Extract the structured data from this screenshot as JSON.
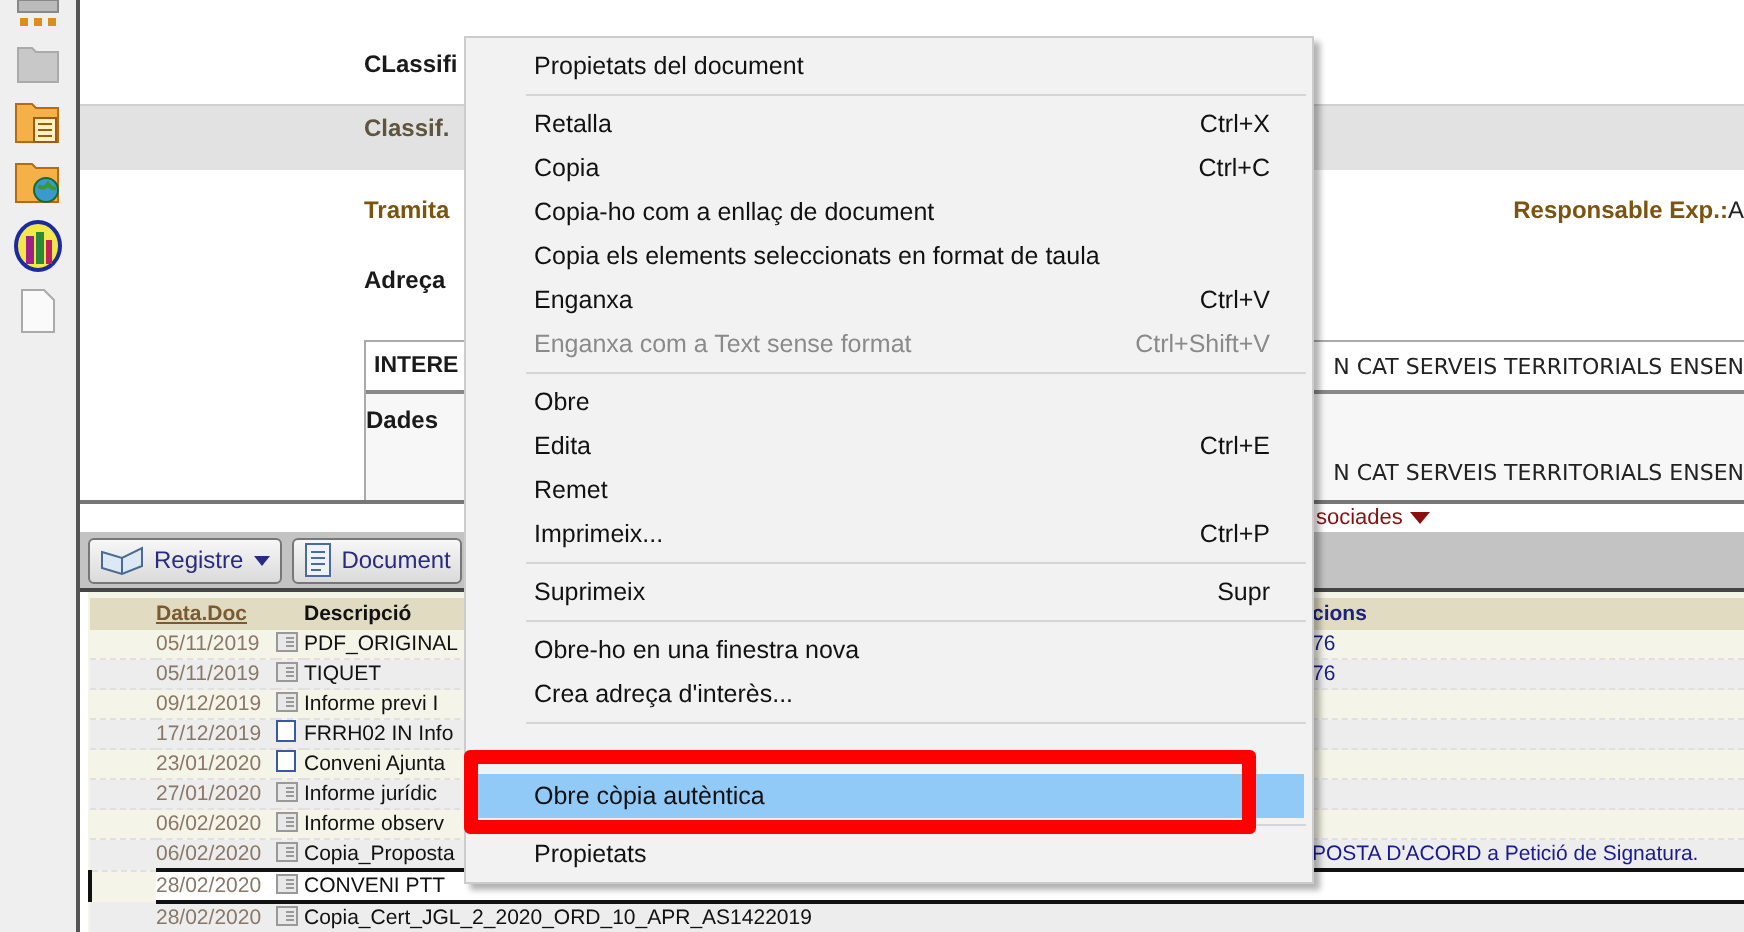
{
  "form": {
    "title": "CLassifi",
    "classification_label": "Classif.",
    "processing_label": "Tramita",
    "responsible_label": "Responsable Exp.:",
    "responsible_value": "A",
    "address_label": "Adreça",
    "interested": {
      "header": "INTERE",
      "header_value": "N CAT SERVEIS TERRITORIALS ENSEN",
      "data_label": "Dades",
      "data_value": "N CAT SERVEIS TERRITORIALS ENSEN"
    }
  },
  "related_link": "sociades",
  "toolbar": {
    "buttons": [
      {
        "label": "Registre",
        "dropdown": true
      },
      {
        "label": "Document",
        "dropdown": false
      }
    ]
  },
  "documents": {
    "columns": [
      "Data.Doc",
      "Descripció",
      "cions"
    ],
    "rows": [
      {
        "date": "05/11/2019",
        "kind": "file",
        "description": "PDF_ORIGINAL",
        "note": "76",
        "selected": false
      },
      {
        "date": "05/11/2019",
        "kind": "file",
        "description": "TIQUET",
        "note": "76",
        "selected": false
      },
      {
        "date": "09/12/2019",
        "kind": "file",
        "description": "Informe previ I",
        "selected": false
      },
      {
        "date": "17/12/2019",
        "kind": "page",
        "description": "FRRH02 IN Info",
        "selected": false
      },
      {
        "date": "23/01/2020",
        "kind": "page",
        "description": "Conveni Ajunta",
        "selected": false
      },
      {
        "date": "27/01/2020",
        "kind": "file",
        "description": "Informe jurídic",
        "selected": false
      },
      {
        "date": "06/02/2020",
        "kind": "file",
        "description": "Informe observ",
        "selected": false
      },
      {
        "date": "06/02/2020",
        "kind": "file",
        "description": "Copia_Proposta",
        "note": "POSTA D'ACORD a Petició de Signatura.",
        "selected": false
      },
      {
        "date": "28/02/2020",
        "kind": "file",
        "description": "CONVENI PTT",
        "selected": true
      },
      {
        "date": "28/02/2020",
        "kind": "file",
        "description": "Copia_Cert_JGL_2_2020_ORD_10_APR_AS1422019",
        "selected": false
      }
    ]
  },
  "context_menu": {
    "items": [
      {
        "kind": "item",
        "label": "Propietats del document",
        "disabled": false,
        "selected": false
      },
      {
        "kind": "separator"
      },
      {
        "kind": "item",
        "label": "Retalla",
        "shortcut": "Ctrl+X",
        "disabled": false,
        "selected": false
      },
      {
        "kind": "item",
        "label": "Copia",
        "shortcut": "Ctrl+C",
        "disabled": false,
        "selected": false
      },
      {
        "kind": "item",
        "label": "Copia-ho com a enllaç de document",
        "disabled": false,
        "selected": false
      },
      {
        "kind": "item",
        "label": "Copia els elements seleccionats en format de taula",
        "disabled": false,
        "selected": false
      },
      {
        "kind": "item",
        "label": "Enganxa",
        "shortcut": "Ctrl+V",
        "disabled": false,
        "selected": false
      },
      {
        "kind": "item",
        "label": "Enganxa com a Text sense format",
        "shortcut": "Ctrl+Shift+V",
        "disabled": true,
        "selected": false
      },
      {
        "kind": "separator"
      },
      {
        "kind": "item",
        "label": "Obre",
        "disabled": false,
        "selected": false
      },
      {
        "kind": "item",
        "label": "Edita",
        "shortcut": "Ctrl+E",
        "disabled": false,
        "selected": false
      },
      {
        "kind": "item",
        "label": "Remet",
        "disabled": false,
        "selected": false
      },
      {
        "kind": "item",
        "label": "Imprimeix...",
        "shortcut": "Ctrl+P",
        "disabled": false,
        "selected": false
      },
      {
        "kind": "separator"
      },
      {
        "kind": "item",
        "label": "Suprimeix",
        "shortcut": "Supr",
        "disabled": false,
        "selected": false
      },
      {
        "kind": "separator"
      },
      {
        "kind": "item",
        "label": "Obre-ho en una finestra nova",
        "disabled": false,
        "selected": false
      },
      {
        "kind": "item",
        "label": "Crea adreça d'interès...",
        "disabled": false,
        "selected": false
      },
      {
        "kind": "separator"
      },
      {
        "kind": "covered"
      },
      {
        "kind": "item",
        "label": "Obre còpia autèntica",
        "disabled": false,
        "selected": true
      },
      {
        "kind": "separator"
      },
      {
        "kind": "item",
        "label": "Propietats",
        "disabled": false,
        "selected": false
      }
    ]
  }
}
